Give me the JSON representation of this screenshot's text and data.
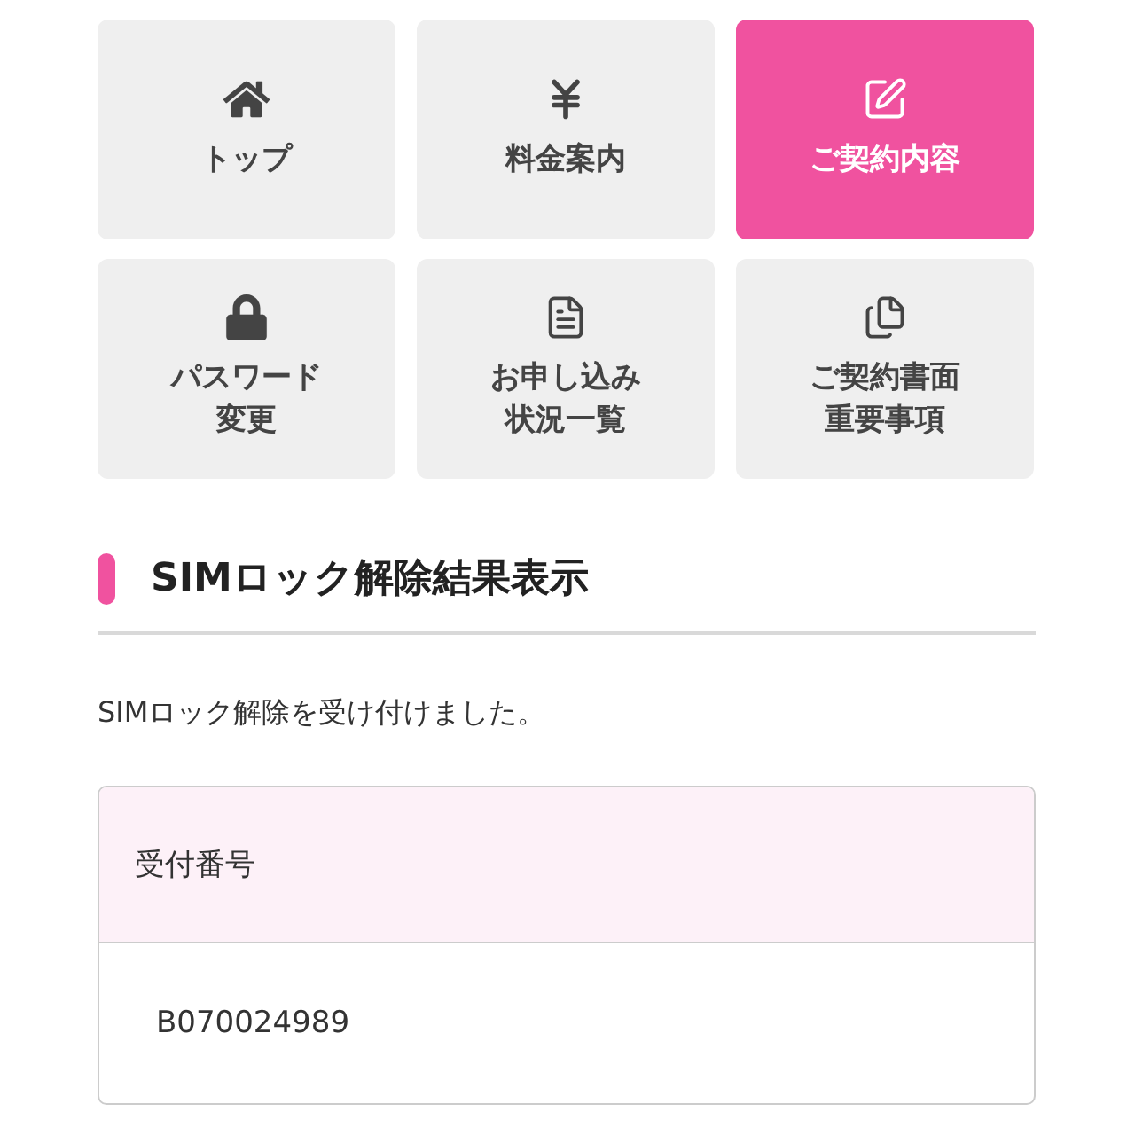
{
  "menu": [
    {
      "lines": [
        "トップ"
      ],
      "selected": false
    },
    {
      "lines": [
        "料金案内"
      ],
      "selected": false
    },
    {
      "lines": [
        "ご契約内容"
      ],
      "selected": true
    },
    {
      "lines": [
        "パスワード",
        "変更"
      ],
      "selected": false
    },
    {
      "lines": [
        "お申し込み",
        "状況一覧"
      ],
      "selected": false
    },
    {
      "lines": [
        "ご契約書面",
        "重要事項"
      ],
      "selected": false
    }
  ],
  "section": {
    "title": "SIMロック解除結果表示"
  },
  "message": "SIMロック解除を受け付けました。",
  "result_table": {
    "label": "受付番号",
    "value": "B070024989"
  }
}
